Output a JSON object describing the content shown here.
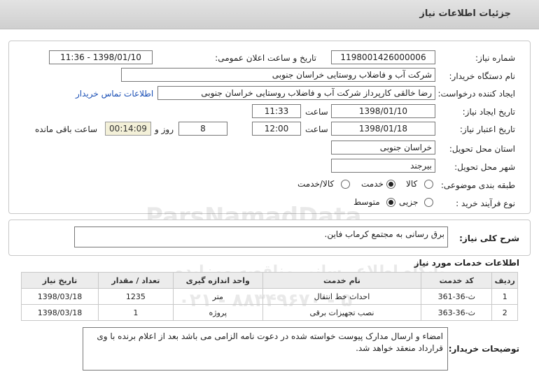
{
  "header": {
    "title": "جزئیات اطلاعات نیاز"
  },
  "form": {
    "need_number": {
      "label": "شماره نیاز:",
      "value": "1198001426000006"
    },
    "announce": {
      "label": "تاریخ و ساعت اعلان عمومی:",
      "value": "1398/01/10 - 11:36"
    },
    "buyer": {
      "label": "نام دستگاه خریدار:",
      "value": "شرکت آب و فاضلاب روستایی خراسان جنوبی"
    },
    "requester": {
      "label": "ایجاد کننده درخواست:",
      "value": "رضا  خالقی کارپرداز شرکت آب و فاضلاب روستایی خراسان جنوبی",
      "contact_link": "اطلاعات تماس خریدار"
    },
    "created": {
      "label": "تاریخ ایجاد نیاز:",
      "date": "1398/01/10",
      "time_label": "ساعت",
      "time": "11:33"
    },
    "validity": {
      "label": "تاریخ اعتبار نیاز:",
      "date": "1398/01/18",
      "time_label": "ساعت",
      "time": "12:00",
      "days": "8",
      "days_label": "روز و",
      "remaining": "00:14:09",
      "remaining_label": "ساعت باقی مانده"
    },
    "province": {
      "label": "استان محل تحویل:",
      "value": "خراسان جنوبی"
    },
    "city": {
      "label": "شهر محل تحویل:",
      "value": "بیرجند"
    },
    "category": {
      "label": "طبقه بندی موضوعی:",
      "options": [
        "کالا",
        "خدمت",
        "کالا/خدمت"
      ],
      "selected": "خدمت"
    },
    "process": {
      "label": "نوع فرآیند خرید :",
      "options": [
        "جزیی",
        "متوسط"
      ],
      "selected": "متوسط"
    }
  },
  "summary": {
    "label": "شرح کلی نیاز:",
    "value": "برق رسانی به مجتمع کرماب فاین."
  },
  "services": {
    "title": "اطلاعات خدمات مورد نیاز",
    "columns": [
      "ردیف",
      "کد خدمت",
      "نام خدمت",
      "واحد اندازه گیری",
      "تعداد / مقدار",
      "تاریخ نیاز"
    ],
    "rows": [
      [
        "1",
        "ث-36-361",
        "احداث خط انتقال",
        "متر",
        "1235",
        "1398/03/18"
      ],
      [
        "2",
        "ث-36-363",
        "نصب تجهیزات برقی",
        "پروژه",
        "1",
        "1398/03/18"
      ]
    ]
  },
  "buyer_notes": {
    "label": "توضیحات خریدار:",
    "value": "امضاء و ارسال مدارک پیوست خواسته شده در دعوت نامه الزامی می باشد بعد از اعلام برنده با وی قرارداد منعقد خواهد شد."
  },
  "watermarks": {
    "brand": "ParsNamadData",
    "line1": "مرکز فراهم آوری اطلاعات پارس نماد داده ها",
    "line2": "پایگاه اطلاع رسانی مناقصه ومزایده",
    "phone": "۰۲۱ - ۸۸۳۴۹۶۷۰ - ۵"
  }
}
